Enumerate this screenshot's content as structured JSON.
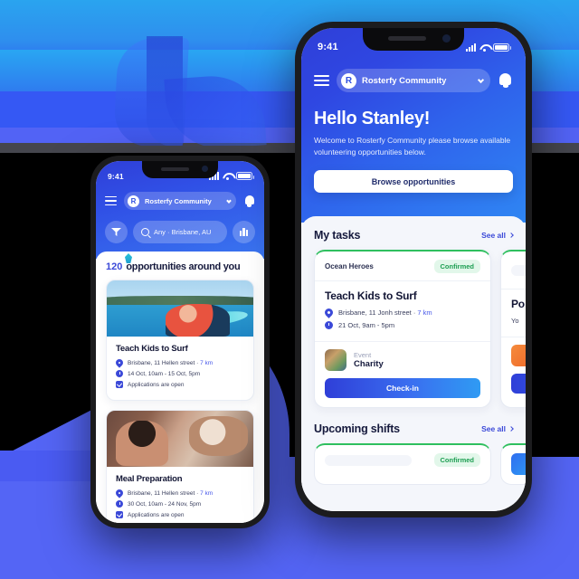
{
  "background": {
    "watermark_logo": "rosterfy-r-logo",
    "accent": "#5465f5",
    "brand_blue": "#2f3fd8"
  },
  "large_phone": {
    "status_bar": {
      "time": "9:41",
      "signal": "signal-icon",
      "wifi": "wifi-icon",
      "battery": "battery-icon"
    },
    "header": {
      "menu": "hamburger-icon",
      "org_logo_letter": "R",
      "org_name": "Rosterfy Community",
      "chevron": "chevron-down-icon",
      "bell": "bell-icon"
    },
    "hero": {
      "greeting": "Hello Stanley!",
      "welcome": "Welcome to Rosterfy Community please browse available volunteering opportunities below.",
      "cta_label": "Browse opportunities"
    },
    "my_tasks": {
      "title": "My tasks",
      "see_all": "See all",
      "cards": [
        {
          "org": "Ocean Heroes",
          "status": "Confirmed",
          "title": "Teach Kids to Surf",
          "location": "Brisbane, 11 Jonh street · ",
          "distance": "7 km",
          "datetime": "21 Oct, 9am - 5pm",
          "event_label": "Event",
          "event_value": "Charity",
          "action": "Check-in"
        },
        {
          "title_partial": "Po",
          "subtitle_partial": "Yo"
        }
      ]
    },
    "upcoming_shifts": {
      "title": "Upcoming shifts",
      "see_all": "See all",
      "status": "Confirmed"
    }
  },
  "small_phone": {
    "status_bar": {
      "time": "9:41"
    },
    "header": {
      "org_logo_letter": "R",
      "org_name": "Rosterfy Community"
    },
    "search": {
      "filter": "filter-icon",
      "value": "Any · Brisbane, AU",
      "placeholder": "Any · Brisbane, AU",
      "map_toggle": "map-icon"
    },
    "results": {
      "count": "120",
      "heading": "opportunities around you",
      "cards": [
        {
          "title": "Teach Kids to Surf",
          "location": "Brisbane, 11 Hellen street · ",
          "distance": "7 km",
          "datetime": "14 Oct, 10am - 15 Oct, 5pm",
          "applications": "Applications are open",
          "image": "surfing-photo"
        },
        {
          "title": "Meal Preparation",
          "location": "Brisbane, 11 Hellen street · ",
          "distance": "7 km",
          "datetime": "30 Oct, 10am - 24 Nov, 5pm",
          "applications": "Applications are open",
          "image": "meal-prep-photo"
        }
      ]
    }
  }
}
